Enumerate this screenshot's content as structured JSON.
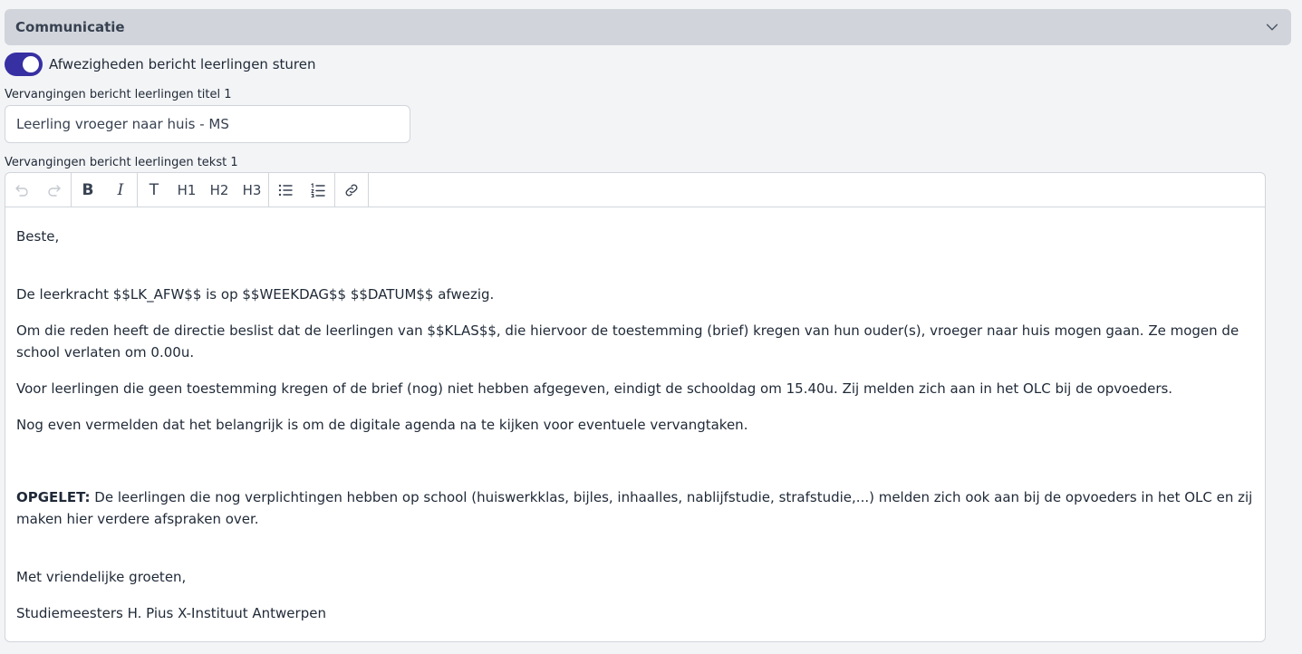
{
  "section": {
    "title": "Communicatie",
    "chevron_icon": "chevron-down-icon"
  },
  "toggle": {
    "label": "Afwezigheden bericht leerlingen sturen",
    "checked": true,
    "color": "#3730a3"
  },
  "title_field": {
    "label": "Vervangingen bericht leerlingen titel 1",
    "value": "Leerling vroeger naar huis - MS"
  },
  "text_field": {
    "label": "Vervangingen bericht leerlingen tekst 1",
    "toolbar": {
      "undo_icon": "undo-icon",
      "redo_icon": "redo-icon",
      "bold": "B",
      "italic": "I",
      "paragraph": "T",
      "h1": "H1",
      "h2": "H2",
      "h3": "H3",
      "bullet_icon": "bullet-list-icon",
      "ordered_icon": "ordered-list-icon",
      "link_icon": "link-icon"
    },
    "content": {
      "greeting": "Beste,",
      "p1": "De leerkracht $$LK_AFW$$ is op $$WEEKDAG$$ $$DATUM$$ afwezig.",
      "p2": "Om die reden heeft de directie beslist dat de leerlingen van $$KLAS$$, die hiervoor de toestemming (brief) kregen van hun ouder(s), vroeger naar huis mogen gaan. Ze mogen de school verlaten om 0.00u.",
      "p3": "Voor leerlingen die geen toestemming kregen of de brief (nog) niet hebben afgegeven, eindigt de schooldag om 15.40u. Zij melden zich aan in het OLC bij de opvoeders.",
      "p4": "Nog even vermelden dat het belangrijk is om de digitale agenda na te kijken voor eventuele vervangtaken.",
      "warning_label": "OPGELET:",
      "warning_text": " De leerlingen die nog verplichtingen hebben op school (huiswerkklas, bijles, inhaalles, nablijfstudie, strafstudie,...) melden zich ook aan bij de opvoeders in het OLC en zij maken hier verdere afspraken over.",
      "closing": "Met vriendelijke groeten,",
      "signature": "Studiemeesters H. Pius X-Instituut Antwerpen"
    }
  }
}
